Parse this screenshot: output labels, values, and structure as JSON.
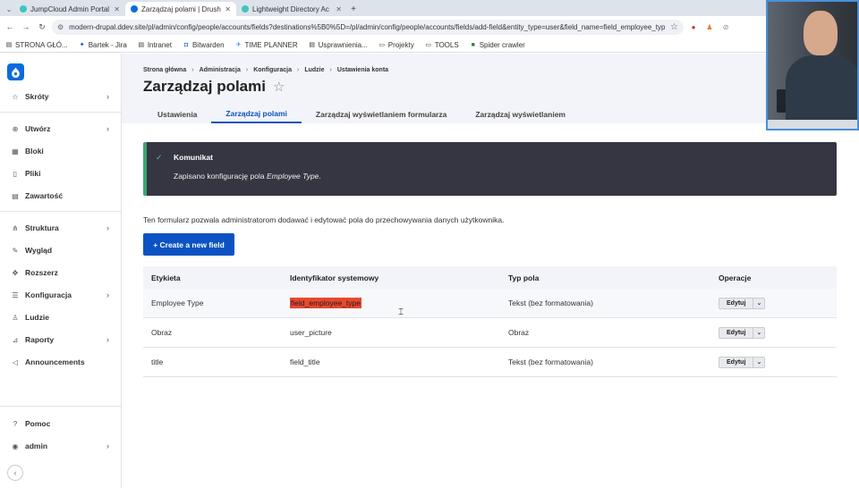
{
  "browser": {
    "tabs": [
      {
        "label": "JumpCloud Admin Portal",
        "color": "#3cc6c0",
        "active": false
      },
      {
        "label": "Zarządzaj polami | Drush",
        "color": "#0b6bde",
        "active": true
      },
      {
        "label": "Lightweight Directory Ac",
        "color": "#3cc6c0",
        "active": false
      }
    ],
    "url": "modern-drupal.ddev.site/pl/admin/config/people/accounts/fields?destinations%5B0%5D=/pl/admin/config/people/accounts/fields/add-field&entity_type=user&field_name=field_employee_type",
    "bookmarks": [
      {
        "label": "STRONA GŁÓ...",
        "icon": "doc-icon"
      },
      {
        "label": "Bartek - Jira",
        "icon": "jira-icon"
      },
      {
        "label": "Intranet",
        "icon": "doc-icon"
      },
      {
        "label": "Bitwarden",
        "icon": "shield-icon"
      },
      {
        "label": "TIME PLANNER",
        "icon": "plane-icon"
      },
      {
        "label": "Usprawnienia...",
        "icon": "doc-icon"
      },
      {
        "label": "Projekty",
        "icon": "folder-icon"
      },
      {
        "label": "TOOLS",
        "icon": "folder-icon"
      },
      {
        "label": "Spider crawler",
        "icon": "spider-icon"
      }
    ]
  },
  "sidebar": {
    "items": [
      {
        "label": "Skróty",
        "icon": "star-icon",
        "chevron": true
      },
      {
        "label": "Utwórz",
        "icon": "plus-circle-icon",
        "chevron": true
      },
      {
        "label": "Bloki",
        "icon": "grid-icon",
        "chevron": false
      },
      {
        "label": "Pliki",
        "icon": "file-icon",
        "chevron": false
      },
      {
        "label": "Zawartość",
        "icon": "content-icon",
        "chevron": false
      },
      {
        "label": "Struktura",
        "icon": "structure-icon",
        "chevron": true
      },
      {
        "label": "Wygląd",
        "icon": "brush-icon",
        "chevron": false
      },
      {
        "label": "Rozszerz",
        "icon": "puzzle-icon",
        "chevron": false
      },
      {
        "label": "Konfiguracja",
        "icon": "sliders-icon",
        "chevron": true
      },
      {
        "label": "Ludzie",
        "icon": "people-icon",
        "chevron": false
      },
      {
        "label": "Raporty",
        "icon": "chart-icon",
        "chevron": true
      },
      {
        "label": "Announcements",
        "icon": "megaphone-icon",
        "chevron": false
      }
    ],
    "help": "Pomoc",
    "user": "admin"
  },
  "header": {
    "breadcrumbs": [
      "Strona główna",
      "Administracja",
      "Konfiguracja",
      "Ludzie",
      "Ustawienia konta"
    ],
    "title": "Zarządzaj polami",
    "tabs": [
      {
        "label": "Ustawienia",
        "active": false
      },
      {
        "label": "Zarządzaj polami",
        "active": true
      },
      {
        "label": "Zarządzaj wyświetlaniem formularza",
        "active": false
      },
      {
        "label": "Zarządzaj wyświetlaniem",
        "active": false
      }
    ]
  },
  "message": {
    "title": "Komunikat",
    "text_prefix": "Zapisano konfigurację pola ",
    "field": "Employee Type",
    "text_suffix": "."
  },
  "intro": "Ten formularz pozwala administratorom dodawać i edytować pola do przechowywania danych użytkownika.",
  "create_button": "+ Create a new field",
  "table": {
    "headers": [
      "Etykieta",
      "Identyfikator systemowy",
      "Typ pola",
      "Operacje"
    ],
    "rows": [
      {
        "label": "Employee Type",
        "machine": "field_employee_type",
        "type": "Tekst (bez formatowania)",
        "op": "Edytuj",
        "highlight": true
      },
      {
        "label": "Obraz",
        "machine": "user_picture",
        "type": "Obraz",
        "op": "Edytuj",
        "highlight": false
      },
      {
        "label": "title",
        "machine": "field_title",
        "type": "Tekst (bez formatowania)",
        "op": "Edytuj",
        "highlight": false
      }
    ]
  },
  "colors": {
    "accent": "#0b53c3",
    "message_bg": "#353641",
    "success": "#3aa774",
    "highlight": "#e8472e"
  }
}
